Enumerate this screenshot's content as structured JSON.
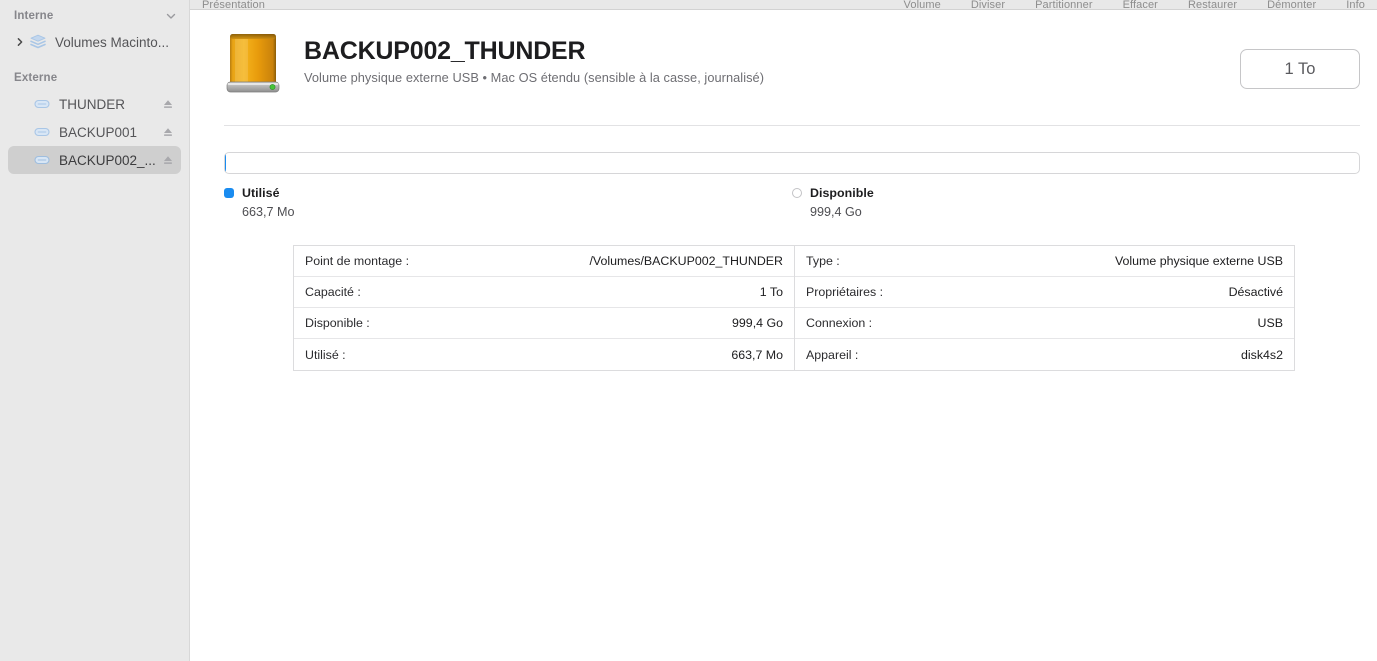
{
  "toolbar": {
    "items_left": [
      "Présentation"
    ],
    "items_right": [
      "Volume",
      "Diviser",
      "Partitionner",
      "Effacer",
      "Restaurer",
      "Démonter",
      "Info"
    ]
  },
  "sidebar": {
    "sections": [
      {
        "title": "Interne",
        "collapse_icon": "chevron-down-icon",
        "items": [
          {
            "label": "Volumes Macinto...",
            "icon": "disk-stack-icon",
            "disclosure": "chevron-right-icon",
            "eject": false,
            "selected": false,
            "indent": 1
          }
        ]
      },
      {
        "title": "Externe",
        "collapse_icon": null,
        "items": [
          {
            "label": "THUNDER",
            "icon": "external-drive-icon",
            "disclosure": null,
            "eject": true,
            "selected": false,
            "indent": 2
          },
          {
            "label": "BACKUP001",
            "icon": "external-drive-icon",
            "disclosure": null,
            "eject": true,
            "selected": false,
            "indent": 2
          },
          {
            "label": "BACKUP002_...",
            "icon": "external-drive-icon",
            "disclosure": null,
            "eject": true,
            "selected": true,
            "indent": 2
          }
        ]
      }
    ]
  },
  "header": {
    "icon": "external-hard-drive-orange-icon",
    "title": "BACKUP002_THUNDER",
    "subtitle": "Volume physique externe USB • Mac OS étendu (sensible à la casse, journalisé)",
    "capacity_badge": "1 To"
  },
  "usage": {
    "used_percent": 0.065,
    "legend": [
      {
        "name": "Utilisé",
        "value": "663,7 Mo",
        "swatch": "filled",
        "color": "#1a8cf0"
      },
      {
        "name": "Disponible",
        "value": "999,4 Go",
        "swatch": "hollow",
        "color": "#ffffff"
      }
    ]
  },
  "details": {
    "left": [
      {
        "key": "Point de montage :",
        "value": "/Volumes/BACKUP002_THUNDER"
      },
      {
        "key": "Capacité :",
        "value": "1 To"
      },
      {
        "key": "Disponible :",
        "value": "999,4 Go"
      },
      {
        "key": "Utilisé :",
        "value": "663,7 Mo"
      }
    ],
    "right": [
      {
        "key": "Type :",
        "value": "Volume physique externe USB"
      },
      {
        "key": "Propriétaires :",
        "value": "Désactivé"
      },
      {
        "key": "Connexion :",
        "value": "USB"
      },
      {
        "key": "Appareil :",
        "value": "disk4s2"
      }
    ]
  }
}
